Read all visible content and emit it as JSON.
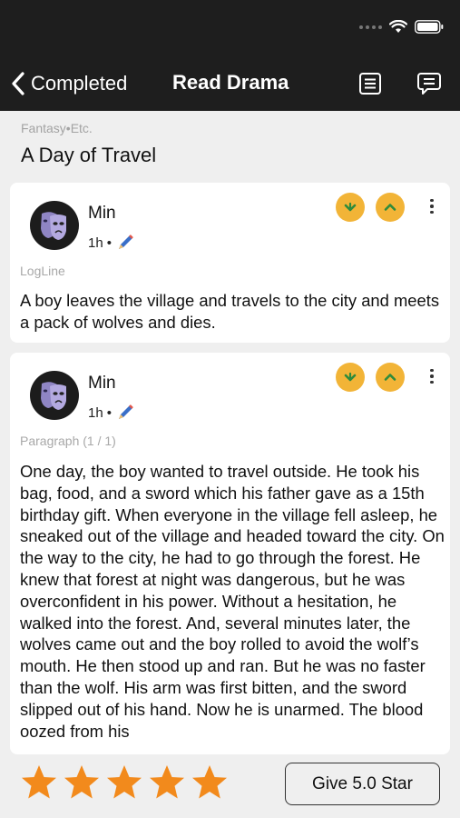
{
  "nav": {
    "back_label": "Completed",
    "title": "Read Drama"
  },
  "story": {
    "genre": "Fantasy•Etc.",
    "title": "A Day of Travel"
  },
  "cards": [
    {
      "author": "Min",
      "time": "1h",
      "separator": "•",
      "section": "LogLine",
      "text": "A boy leaves the village and travels to the city and meets a pack of wolves and dies."
    },
    {
      "author": "Min",
      "time": "1h",
      "separator": "•",
      "section": "Paragraph (1 / 1)",
      "text": "One day, the boy wanted to travel outside. He took his bag, food, and a sword which his father gave as a 15th birthday gift. When everyone in the village fell asleep, he sneaked out of the village and headed toward the city. On the way to the city, he had to go through the forest. He knew that forest at night was dangerous, but he was overconfident in his power. Without a hesitation, he walked into the forest. And, several minutes later, the wolves came out and the boy rolled to avoid the wolf’s mouth. He then stood up and ran. But he was no faster than the wolf. His arm was first bitten, and the sword slipped out of his hand. Now he is unarmed. The blood oozed from his"
    }
  ],
  "rating": {
    "stars": 5,
    "max": 5,
    "button_label": "Give 5.0 Star"
  },
  "colors": {
    "bar": "#1e1e1e",
    "vote": "#f2b437",
    "vote_arrow": "#2e8b3c",
    "star": "#f28a1c"
  },
  "icons": [
    "back-chevron-icon",
    "list-icon",
    "comment-icon",
    "downvote-icon",
    "upvote-icon",
    "more-icon",
    "pencil-icon",
    "star-icon",
    "wifi-icon",
    "battery-icon"
  ]
}
